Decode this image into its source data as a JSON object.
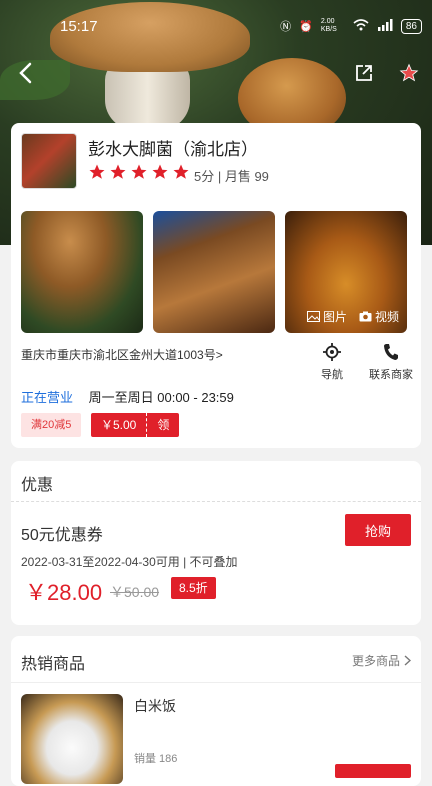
{
  "status_bar": {
    "time": "15:17",
    "net_speed": "2.00 KB/S",
    "battery": "86"
  },
  "store": {
    "name": "彭水大脚菌（渝北店）",
    "rating": 5,
    "rating_text": "5分 | 月售 99",
    "photos_label": "图片",
    "video_label": "视频",
    "address": "重庆市重庆市渝北区金州大道1003号>",
    "nav_label": "导航",
    "contact_label": "联系商家",
    "open_status": "正在营业",
    "hours": "周一至周日  00:00 - 23:59",
    "promo_tag": "满20减5",
    "voucher_amount": "￥5.00",
    "voucher_get": "领"
  },
  "deals": {
    "title": "优惠",
    "item_name": "50元优惠券",
    "buy_label": "抢购",
    "validity": "2022-03-31至2022-04-30可用 | 不可叠加",
    "price": "￥28.00",
    "original_price": "￥50.00",
    "discount": "8.5折"
  },
  "hot": {
    "title": "热销商品",
    "more_label": "更多商品",
    "product": {
      "name": "白米饭",
      "sales": "销量 186"
    }
  },
  "colors": {
    "accent": "#e0202a",
    "link": "#1f6fdc",
    "star": "#e0202a"
  },
  "icons": [
    "back-arrow-icon",
    "share-icon",
    "star-icon",
    "location-icon",
    "phone-icon",
    "image-icon",
    "camera-icon",
    "chevron-right-icon"
  ]
}
